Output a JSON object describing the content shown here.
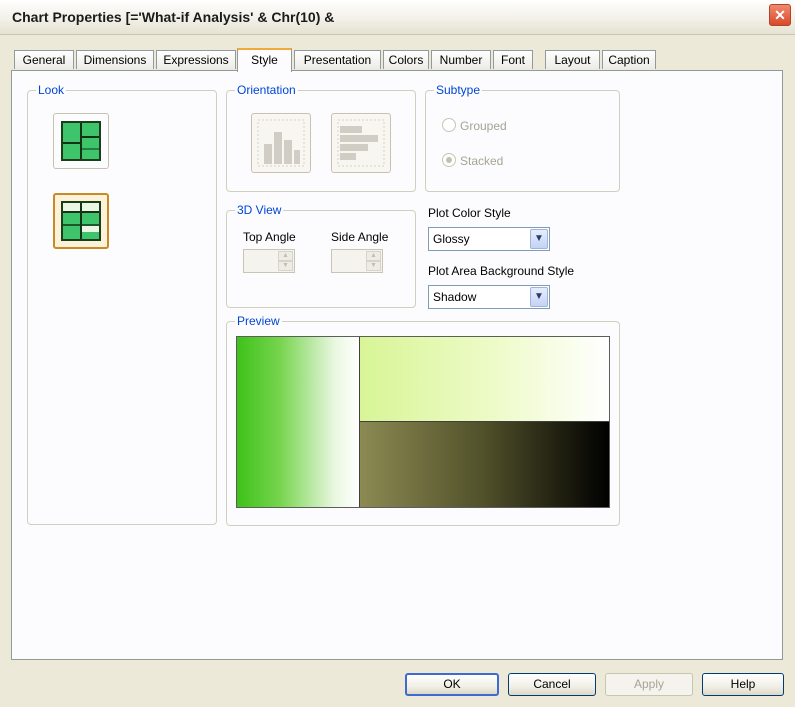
{
  "window": {
    "title": "Chart Properties [='What-if Analysis' & Chr(10) &",
    "close_symbol": "✕"
  },
  "tabs": [
    {
      "label": "General"
    },
    {
      "label": "Dimensions"
    },
    {
      "label": "Expressions"
    },
    {
      "label": "Style",
      "active": true
    },
    {
      "label": "Presentation"
    },
    {
      "label": "Colors"
    },
    {
      "label": "Number"
    },
    {
      "label": "Font"
    },
    {
      "label": "Layout"
    },
    {
      "label": "Caption"
    }
  ],
  "look": {
    "title": "Look",
    "options": [
      {
        "name": "look-standard"
      },
      {
        "name": "look-with-split",
        "selected": true
      }
    ]
  },
  "orientation": {
    "title": "Orientation",
    "options": [
      "vertical-bars-icon",
      "horizontal-bars-icon"
    ]
  },
  "subtype": {
    "title": "Subtype",
    "options": [
      {
        "label": "Grouped",
        "checked": false
      },
      {
        "label": "Stacked",
        "checked": true
      }
    ],
    "disabled": true
  },
  "view3d": {
    "title": "3D View",
    "top_angle_label": "Top Angle",
    "side_angle_label": "Side Angle",
    "top_angle_value": "",
    "side_angle_value": ""
  },
  "plot_color_style": {
    "label": "Plot Color Style",
    "value": "Glossy"
  },
  "plot_area_bg_style": {
    "label": "Plot Area Background Style",
    "value": "Shadow"
  },
  "preview": {
    "title": "Preview"
  },
  "buttons": {
    "ok": "OK",
    "cancel": "Cancel",
    "apply": "Apply",
    "help": "Help"
  },
  "colors": {
    "accent_tab": "#f2a93b",
    "group_title": "#0046d5",
    "close": "#d9482a"
  }
}
